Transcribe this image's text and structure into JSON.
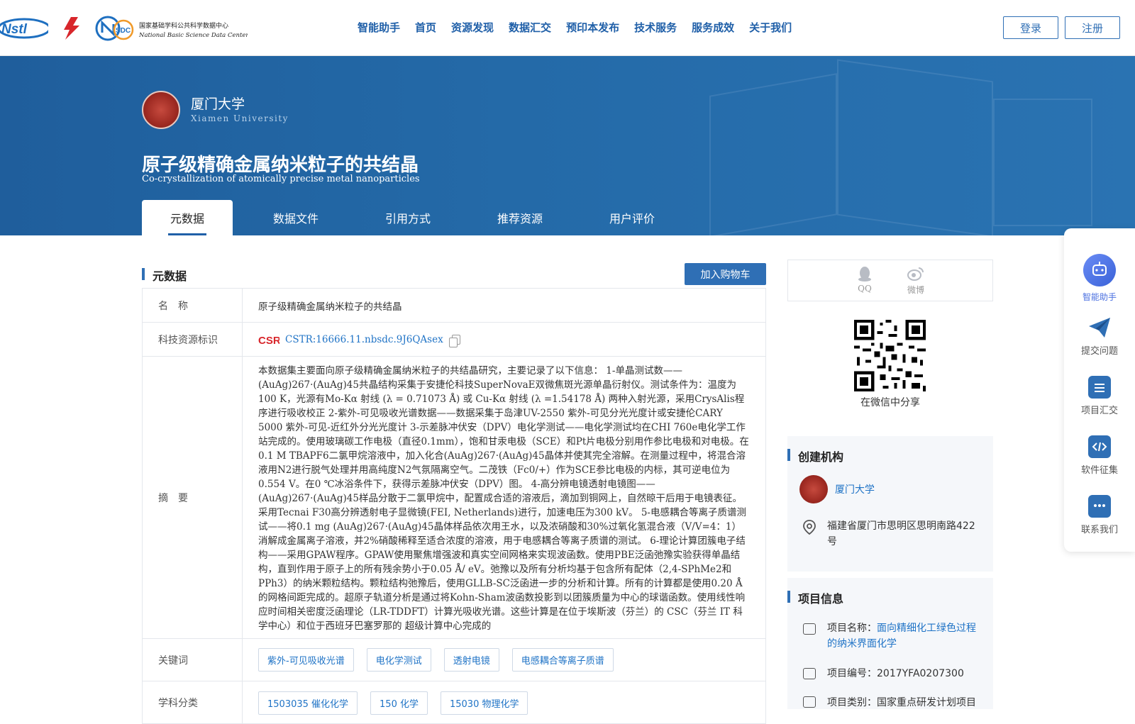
{
  "header": {
    "logos": [
      "NSTL",
      "国家基础学科公共科学数据中心"
    ],
    "logo_nsdc_cn": "国家基础学科公共科学数据中心",
    "logo_nsdc_en": "National Basic Science Data Center",
    "nav": [
      "智能助手",
      "首页",
      "资源发现",
      "数据汇交",
      "预印本发布",
      "技术服务",
      "服务成效",
      "关于我们"
    ],
    "login": "登录",
    "register": "注册"
  },
  "banner": {
    "institution": "厦门大学",
    "institution_en": "Xiamen University",
    "title_cn": "原子级精确金属纳米粒子的共结晶",
    "title_en": "Co-crystallization of atomically precise metal nanoparticles",
    "tabs": [
      "元数据",
      "数据文件",
      "引用方式",
      "推荐资源",
      "用户评价"
    ]
  },
  "main": {
    "section_title": "元数据",
    "cart_button": "加入购物车",
    "rows": {
      "name_label": "名　称",
      "name_value": "原子级精确金属纳米粒子的共结晶",
      "id_label": "科技资源标识",
      "id_value": "CSTR:16666.11.nbsdc.9J6QAsex",
      "abstract_label": "摘　要",
      "abstract_value": "本数据集主要面向原子级精确金属纳米粒子的共结晶研究，主要记录了以下信息： 1-单晶测试数——(AuAg)267·(AuAg)45共晶结构采集于安捷伦科技SuperNovaE双微焦斑光源单晶衍射仪。测试条件为：温度为100 K，光源有Mo-Kα 射线 (λ = 0.71073 Å) 或 Cu-Kα 射线 (λ =1.54178 Å) 两种入射光源，采用CrysAlis程序进行吸收校正 2-紫外-可见吸收光谱数据——数据采集于岛津UV-2550 紫外-可见分光光度计或安捷伦CARY 5000 紫外-可见-近红外分光光度计 3-示差脉冲伏安（DPV）电化学测试——电化学测试均在CHI 760e电化学工作站完成的。使用玻璃碳工作电极（直径0.1mm），饱和甘汞电极（SCE）和Pt片电极分别用作参比电极和对电极。在0.1 M TBAPF6二氯甲烷溶液中，加入化合(AuAg)267·(AuAg)45晶体并使其完全溶解。在测量过程中，将混合溶液用N2进行脱气处理并用高纯度N2气氛隔离空气。二茂铁（Fc0/+）作为SCE参比电极的内标，其可逆电位为0.554 V。在0 ℃冰浴条件下，获得示差脉冲伏安（DPV）图。 4-高分辨电镜透射电镜图——(AuAg)267·(AuAg)45样品分散于二氯甲烷中，配置成合适的溶液后，滴加到铜网上，自然晾干后用于电镜表征。采用Tecnai F30高分辨透射电子显微镜(FEI, Netherlands)进行，加速电压为300 kV。 5-电感耦合等离子质谱测试——将0.1 mg (AuAg)267·(AuAg)45晶体样品依次用王水，以及浓硝酸和30%过氧化氢混合液（V/V=4：1）消解成金属离子溶液，并2%硝酸稀释至适合浓度的溶液，用于电感耦合等离子质谱的测试。 6-理论计算团簇电子结构——采用GPAW程序。GPAW使用聚焦增强波和真实空间网格来实现波函数。使用PBE泛函弛豫实验获得单晶结构，直到作用于原子上的所有残余势小于0.05 Å/ eV。弛豫以及所有分析均基于包含所有配体（2,4-SPhMe2和PPh3）的纳米颗粒结构。颗粒结构弛豫后，使用GLLB-SC泛函进一步的分析和计算。所有的计算都是使用0.20 Å的网格间距完成的。超原子轨道分析是通过将Kohn-Sham波函数投影到以团簇质量为中心的球谐函数。使用线性响应时间相关密度泛函理论（LR-TDDFT）计算光吸收光谱。这些计算是在位于埃斯波（芬兰）的 CSC（芬兰 IT 科学中心）和位于西班牙巴塞罗那的 超级计算中心完成的",
      "keywords_label": "关键词",
      "keywords": [
        "紫外-可见吸收光谱",
        "电化学测试",
        "透射电镜",
        "电感耦合等离子质谱"
      ],
      "subject_label": "学科分类",
      "subjects": [
        "1503035 催化化学",
        "150 化学",
        "15030 物理化学"
      ]
    }
  },
  "sidebar": {
    "share_qq": "QQ",
    "share_weibo": "微博",
    "qr_caption": "在微信中分享",
    "org_section": "创建机构",
    "org_name": "厦门大学",
    "org_address": "福建省厦门市思明区思明南路422号",
    "project_section": "项目信息",
    "project_name_label": "项目名称：",
    "project_name": "面向精细化工绿色过程的纳米界面化学",
    "project_no_label": "项目编号：",
    "project_no": "2017YFA0207300",
    "project_type_label": "项目类别：",
    "project_type": "国家重点研发计划项目"
  },
  "float_toolbar": [
    "智能助手",
    "提交问题",
    "项目汇交",
    "软件征集",
    "联系我们"
  ],
  "colors": {
    "primary": "#2f6fb5",
    "banner": "#246aa8",
    "link": "#1f73c6",
    "assistant": "#4a6fe0"
  }
}
